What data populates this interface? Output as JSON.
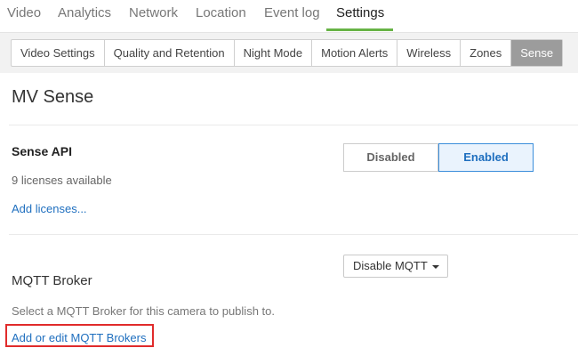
{
  "nav": {
    "tabs": [
      {
        "label": "Video"
      },
      {
        "label": "Analytics"
      },
      {
        "label": "Network"
      },
      {
        "label": "Location"
      },
      {
        "label": "Event log"
      },
      {
        "label": "Settings"
      }
    ],
    "active": "Settings",
    "accent_color": "#67b346"
  },
  "subnav": {
    "tabs": [
      {
        "label": "Video Settings"
      },
      {
        "label": "Quality and Retention"
      },
      {
        "label": "Night Mode"
      },
      {
        "label": "Motion Alerts"
      },
      {
        "label": "Wireless"
      },
      {
        "label": "Zones"
      },
      {
        "label": "Sense"
      }
    ],
    "active": "Sense"
  },
  "page": {
    "title": "MV Sense"
  },
  "sense_api": {
    "heading": "Sense API",
    "licenses_text": "9 licenses available",
    "add_licenses_link": "Add licenses...",
    "toggle": {
      "disabled_label": "Disabled",
      "enabled_label": "Enabled",
      "selected": "Enabled"
    }
  },
  "mqtt": {
    "dropdown_value": "Disable MQTT",
    "heading": "MQTT Broker",
    "description": "Select a MQTT Broker for this camera to publish to.",
    "edit_link": "Add or edit MQTT Brokers",
    "highlight_color": "#e02b2b"
  }
}
